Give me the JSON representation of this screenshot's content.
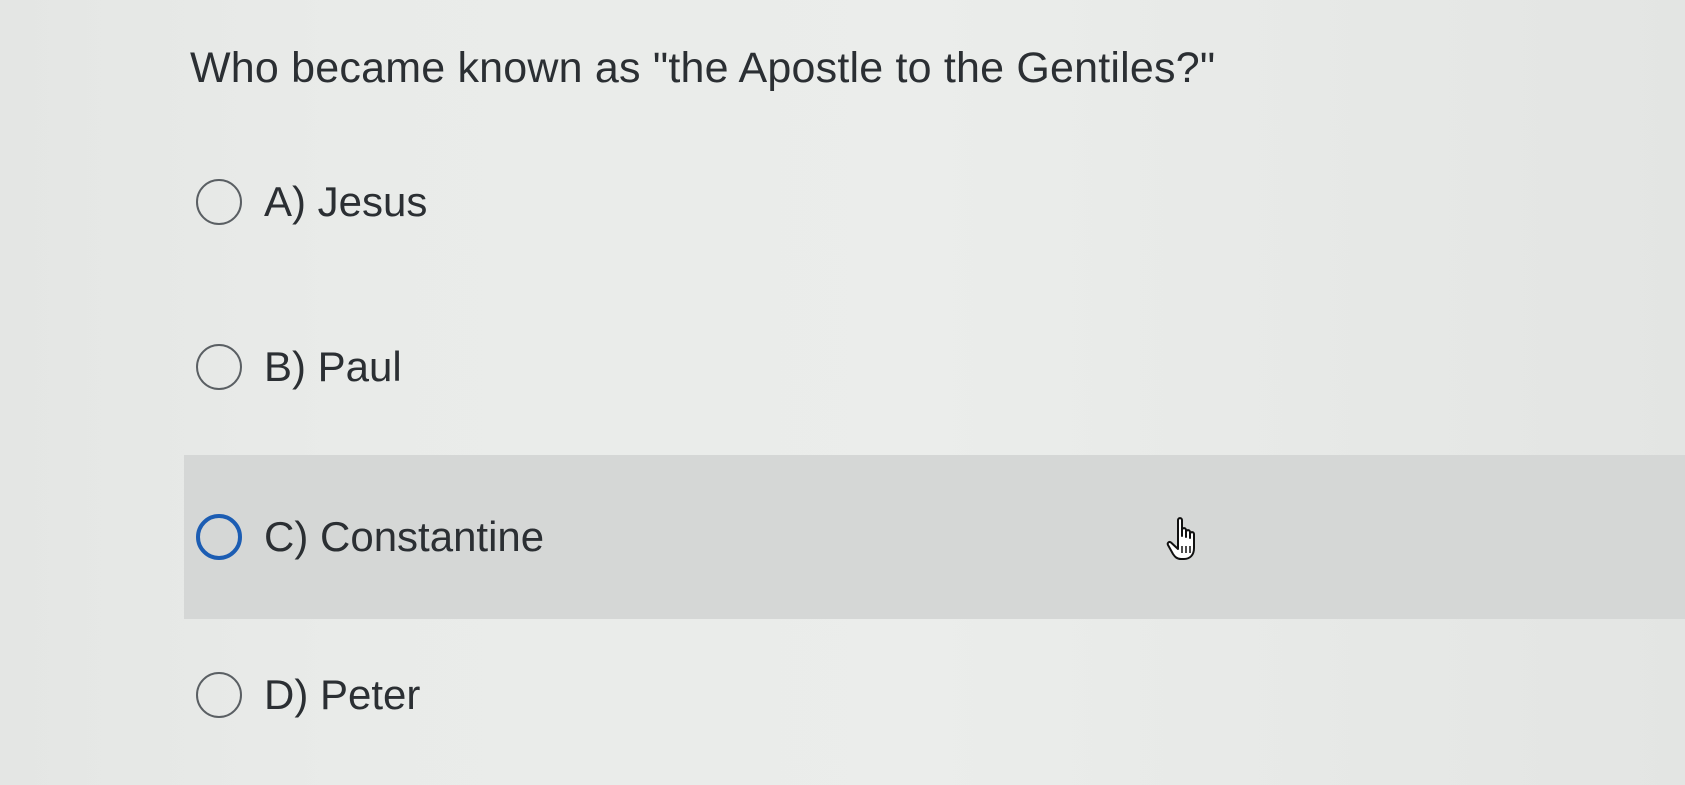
{
  "question": {
    "text": "Who became known as \"the Apostle to the Gentiles?\""
  },
  "options": [
    {
      "letter": "A)",
      "text": "Jesus",
      "hovered": false
    },
    {
      "letter": "B)",
      "text": "Paul",
      "hovered": false
    },
    {
      "letter": "C)",
      "text": "Constantine",
      "hovered": true
    },
    {
      "letter": "D)",
      "text": "Peter",
      "hovered": false
    }
  ],
  "colors": {
    "background": "#e9ebe9",
    "hover_row": "#d5d7d6",
    "radio_focus": "#1c5db3",
    "text": "#2b2f33"
  },
  "icons": {
    "cursor": "hand-pointer-icon",
    "radio": "radio-circle-icon"
  }
}
